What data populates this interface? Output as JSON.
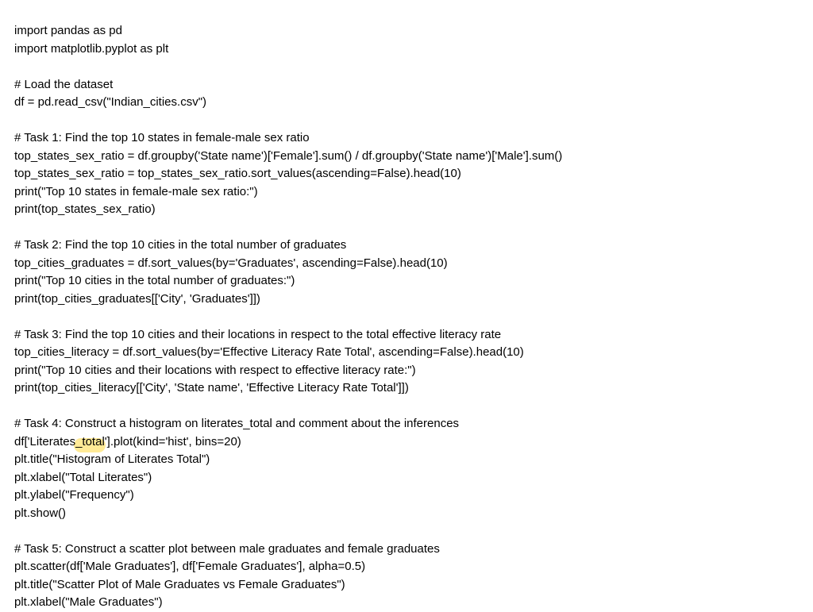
{
  "code": {
    "lines": [
      "import pandas as pd",
      "import matplotlib.pyplot as plt",
      "",
      "# Load the dataset",
      "df = pd.read_csv(\"Indian_cities.csv\")",
      "",
      "# Task 1: Find the top 10 states in female-male sex ratio",
      "top_states_sex_ratio = df.groupby('State name')['Female'].sum() / df.groupby('State name')['Male'].sum()",
      "top_states_sex_ratio = top_states_sex_ratio.sort_values(ascending=False).head(10)",
      "print(\"Top 10 states in female-male sex ratio:\")",
      "print(top_states_sex_ratio)",
      "",
      "# Task 2: Find the top 10 cities in the total number of graduates",
      "top_cities_graduates = df.sort_values(by='Graduates', ascending=False).head(10)",
      "print(\"Top 10 cities in the total number of graduates:\")",
      "print(top_cities_graduates[['City', 'Graduates']])",
      "",
      "# Task 3: Find the top 10 cities and their locations in respect to the total effective literacy rate",
      "top_cities_literacy = df.sort_values(by='Effective Literacy Rate Total', ascending=False).head(10)",
      "print(\"Top 10 cities and their locations with respect to effective literacy rate:\")",
      "print(top_cities_literacy[['City', 'State name', 'Effective Literacy Rate Total']])",
      "",
      "# Task 4: Construct a histogram on literates_total and comment about the inferences",
      "df['Literates_total'].plot(kind='hist', bins=20)",
      "plt.title(\"Histogram of Literates Total\")",
      "plt.xlabel(\"Total Literates\")",
      "plt.ylabel(\"Frequency\")",
      "plt.show()",
      "",
      "# Task 5: Construct a scatter plot between male graduates and female graduates",
      "plt.scatter(df['Male Graduates'], df['Female Graduates'], alpha=0.5)",
      "plt.title(\"Scatter Plot of Male Graduates vs Female Graduates\")",
      "plt.xlabel(\"Male Graduates\")"
    ],
    "highlight_line_index": 23,
    "highlight_text_fragment": "_tota"
  }
}
